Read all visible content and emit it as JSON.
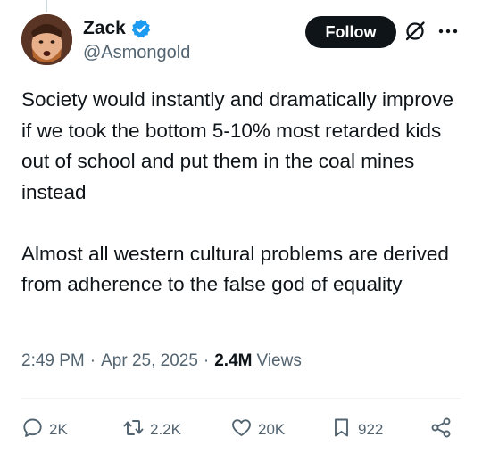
{
  "author": {
    "display_name": "Zack",
    "handle": "@Asmongold",
    "verified": true
  },
  "header": {
    "follow_label": "Follow"
  },
  "tweet": {
    "paragraphs": [
      "Society would instantly and dramatically improve if we took the bottom 5-10% most retarded kids out of school and put them in the coal mines instead",
      "Almost all western cultural problems are derived from adherence to the false god of equality"
    ],
    "time": "2:49 PM",
    "date": "Apr 25, 2025",
    "views_count": "2.4M",
    "views_label": "Views"
  },
  "actions": {
    "replies": "2K",
    "reposts": "2.2K",
    "likes": "20K",
    "bookmarks": "922"
  },
  "colors": {
    "text": "#0f1419",
    "secondary": "#536471",
    "verified_blue": "#1d9bf0",
    "divider": "#eff3f4"
  },
  "icons": [
    "verified-icon",
    "grok-icon",
    "more-icon",
    "reply-icon",
    "repost-icon",
    "like-icon",
    "bookmark-icon",
    "share-icon"
  ]
}
